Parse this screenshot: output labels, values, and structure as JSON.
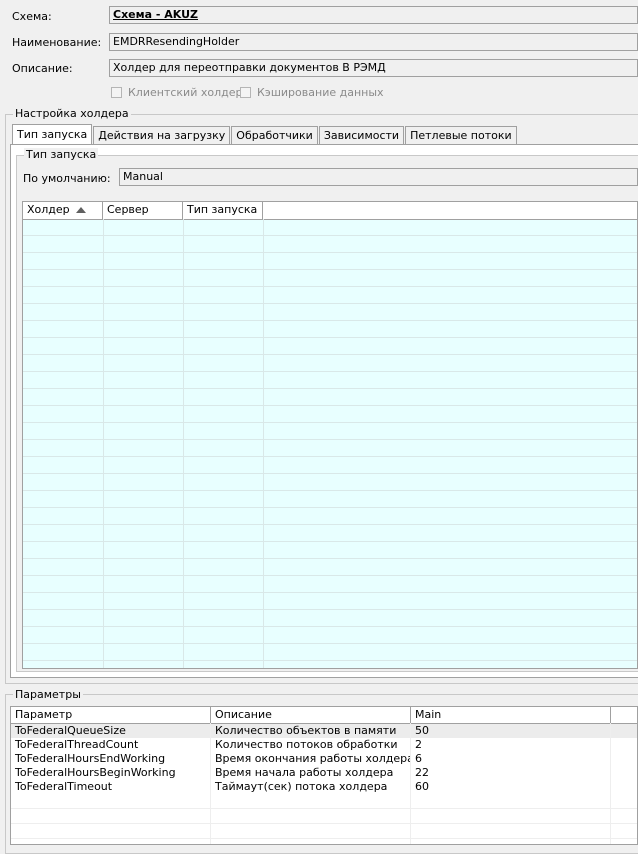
{
  "header": {
    "schema_label": "Схема:",
    "schema_value": "Схема - AKUZ",
    "name_label": "Наименование:",
    "name_value": "EMDRResendingHolder",
    "desc_label": "Описание:",
    "desc_value": "Холдер для переотправки документов В РЭМД",
    "client_holder_label": "Клиентский холдер",
    "caching_label": "Кэширование данных"
  },
  "holder_settings": {
    "group_title": "Настройка холдера",
    "tabs": [
      {
        "label": "Тип запуска",
        "active": true
      },
      {
        "label": "Действия на загрузку"
      },
      {
        "label": "Обработчики"
      },
      {
        "label": "Зависимости"
      },
      {
        "label": "Петлевые потоки"
      }
    ],
    "launch_group_title": "Тип запуска",
    "default_label": "По умолчанию:",
    "default_value": "Manual",
    "grid_columns": [
      "Холдер",
      "Сервер",
      "Тип запуска"
    ]
  },
  "parameters": {
    "group_title": "Параметры",
    "columns": [
      "Параметр",
      "Описание",
      "Main"
    ],
    "rows": [
      {
        "param": "ToFederalQueueSize",
        "desc": "Количество объектов в памяти",
        "main": "50"
      },
      {
        "param": "ToFederalThreadCount",
        "desc": "Количество потоков обработки",
        "main": "2"
      },
      {
        "param": "ToFederalHoursEndWorking",
        "desc": "Время окончания работы холдера",
        "main": "6"
      },
      {
        "param": "ToFederalHoursBeginWorking",
        "desc": "Время начала работы холдера",
        "main": "22"
      },
      {
        "param": "ToFederalTimeout",
        "desc": "Таймаут(сек) потока холдера",
        "main": "60"
      }
    ]
  }
}
